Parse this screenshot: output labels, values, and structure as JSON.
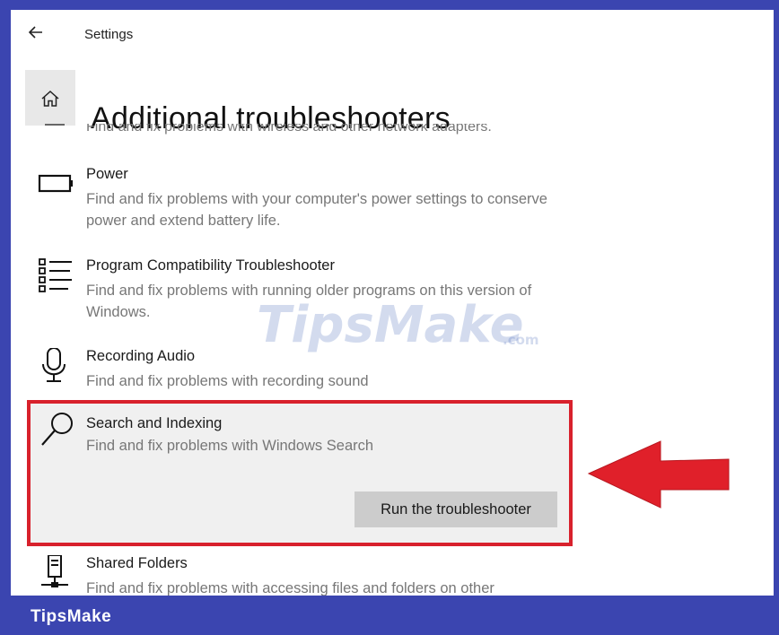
{
  "window": {
    "app_title": "Settings"
  },
  "page": {
    "title": "Additional troubleshooters"
  },
  "clipped_item": {
    "description": "Find and fix problems with wireless and other network adapters."
  },
  "items": [
    {
      "name": "Power",
      "description": "Find and fix problems with your computer's power settings to conserve power and extend battery life.",
      "icon": "battery-icon"
    },
    {
      "name": "Program Compatibility Troubleshooter",
      "description": "Find and fix problems with running older programs on this version of Windows.",
      "icon": "list-icon"
    },
    {
      "name": "Recording Audio",
      "description": "Find and fix problems with recording sound",
      "icon": "microphone-icon"
    },
    {
      "name": "Search and Indexing",
      "description": "Find and fix problems with Windows Search",
      "icon": "search-icon",
      "selected": true
    },
    {
      "name": "Shared Folders",
      "description": "Find and fix problems with accessing files and folders on other",
      "icon": "shared-folder-icon"
    }
  ],
  "selected_item": {
    "run_button_label": "Run the troubleshooter"
  },
  "watermark": {
    "text": "TipsMake",
    "suffix": ".com"
  },
  "footer": {
    "brand": "TipsMake"
  },
  "colors": {
    "frame": "#3b45b0",
    "highlight_border": "#d8212c",
    "arrow": "#e0202a",
    "selected_bg": "#f0f0f0",
    "button_bg": "#cccccc"
  }
}
